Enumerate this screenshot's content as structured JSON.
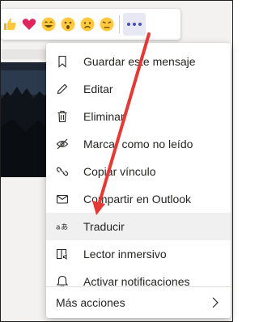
{
  "reaction_bar": {
    "reactions": [
      "like",
      "heart",
      "laugh",
      "surprised",
      "sad",
      "angry"
    ]
  },
  "menu": {
    "items": [
      {
        "icon": "bookmark-icon",
        "label": "Guardar este mensaje"
      },
      {
        "icon": "pencil-icon",
        "label": "Editar"
      },
      {
        "icon": "trash-icon",
        "label": "Eliminar"
      },
      {
        "icon": "mark-unread-icon",
        "label": "Marcar como no leído"
      },
      {
        "icon": "link-icon",
        "label": "Copiar vínculo"
      },
      {
        "icon": "mail-icon",
        "label": "Compartir en Outlook"
      },
      {
        "icon": "translate-icon",
        "label": "Traducir"
      },
      {
        "icon": "immersive-reader-icon",
        "label": "Lector inmersivo"
      },
      {
        "icon": "bell-icon",
        "label": "Activar notificaciones"
      }
    ],
    "footer_label": "Más acciones"
  },
  "colors": {
    "accent": "#464eb8",
    "arrow": "#e53935",
    "highlight": "#f0f0f0"
  }
}
